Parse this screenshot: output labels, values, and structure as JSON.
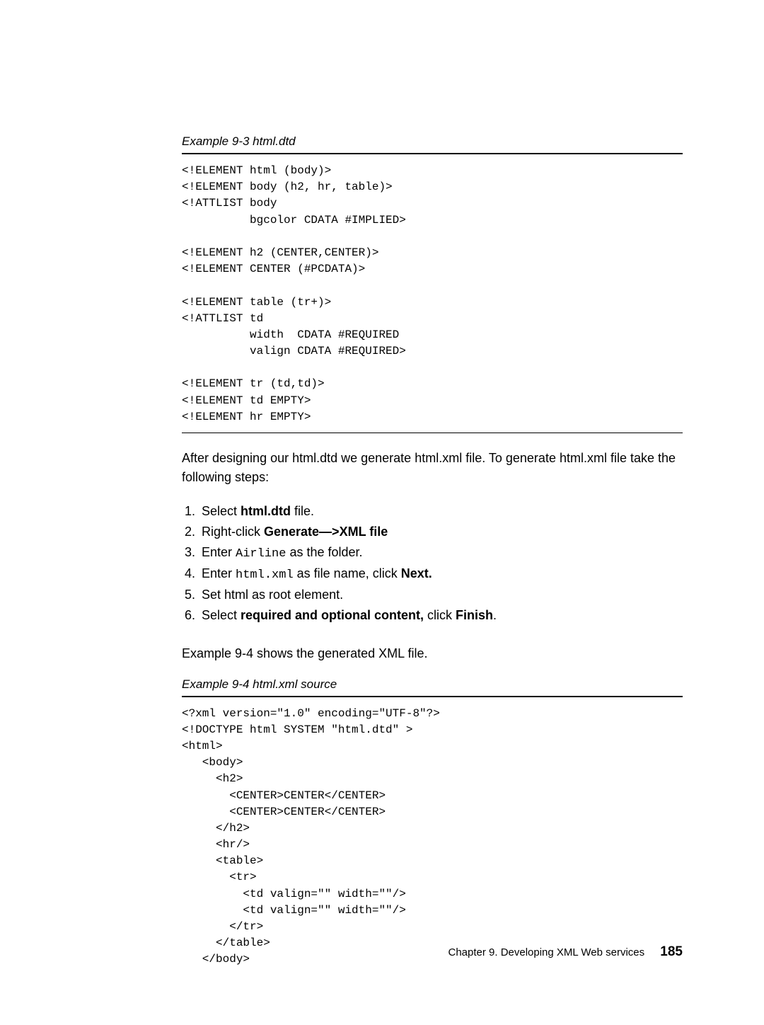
{
  "example1": {
    "caption": "Example 9-3   html.dtd"
  },
  "code1": "<!ELEMENT html (body)>\n<!ELEMENT body (h2, hr, table)>\n<!ATTLIST body\n          bgcolor CDATA #IMPLIED>\n\n<!ELEMENT h2 (CENTER,CENTER)>\n<!ELEMENT CENTER (#PCDATA)>\n\n<!ELEMENT table (tr+)>\n<!ATTLIST td\n          width  CDATA #REQUIRED\n          valign CDATA #REQUIRED>\n\n<!ELEMENT tr (td,td)>\n<!ELEMENT td EMPTY>\n<!ELEMENT hr EMPTY>",
  "para1": "After designing our html.dtd we generate html.xml file. To generate html.xml file take the following steps:",
  "steps": {
    "s1a": "Select ",
    "s1b": "html.dtd",
    "s1c": " file.",
    "s2a": "Right-click ",
    "s2b": "Generate—>XML file",
    "s3a": "Enter ",
    "s3b": "Airline",
    "s3c": " as the folder.",
    "s4a": "Enter ",
    "s4b": "html.xml",
    "s4c": " as file name, click ",
    "s4d": "Next.",
    "s5": "Set html as root element.",
    "s6a": "Select ",
    "s6b": "required and optional content,",
    "s6c": " click ",
    "s6d": "Finish",
    "s6e": "."
  },
  "para2": "Example 9-4 shows the generated XML file.",
  "example2": {
    "caption": "Example 9-4   html.xml source"
  },
  "code2": "<?xml version=\"1.0\" encoding=\"UTF-8\"?>\n<!DOCTYPE html SYSTEM \"html.dtd\" >\n<html>\n   <body>\n     <h2>\n       <CENTER>CENTER</CENTER>\n       <CENTER>CENTER</CENTER>\n     </h2>\n     <hr/>\n     <table>\n       <tr>\n         <td valign=\"\" width=\"\"/>\n         <td valign=\"\" width=\"\"/>\n       </tr>\n     </table>\n   </body>",
  "footer": {
    "chapter": "Chapter 9. Developing XML Web services",
    "page": "185"
  }
}
